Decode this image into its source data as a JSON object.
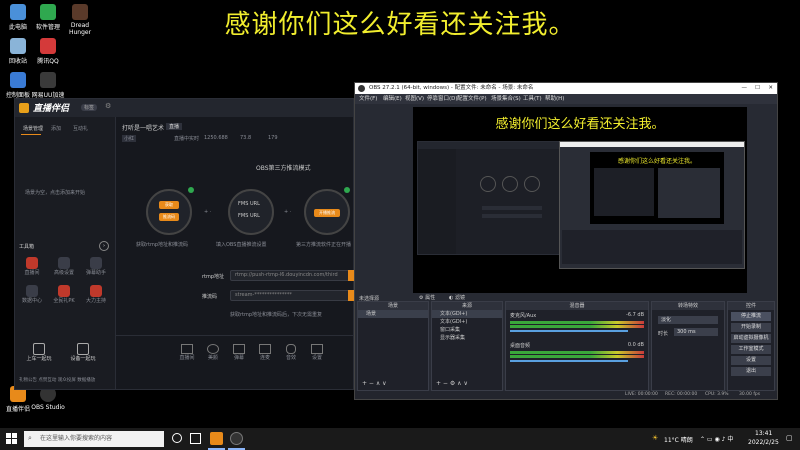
{
  "caption": "感谢你们这么好看还关注我。",
  "desktop_icons": [
    {
      "label": "此电脑",
      "color": "#4a90d9"
    },
    {
      "label": "软件管理",
      "color": "#2fa84f"
    },
    {
      "label": "Dread Hunger",
      "color": "#5a3a2a"
    },
    {
      "label": "回收站",
      "color": "#8ab4d8"
    },
    {
      "label": "腾讯QQ",
      "color": "#d43a3a"
    },
    {
      "label": "控制面板",
      "color": "#3a7bd5"
    },
    {
      "label": "网易UU加速",
      "color": "#3a3a3a"
    }
  ],
  "taskbar_icons": [
    {
      "label": "直播伴侣"
    },
    {
      "label": "OBS Studio"
    }
  ],
  "zhibo": {
    "logo": "直播伴侣",
    "badge": "标签",
    "side_tabs": [
      "场景管理",
      "添加",
      "互动礼"
    ],
    "side_empty_text": "场景为空，点击添加来开始",
    "toolbox_title": "工具箱",
    "tools": [
      {
        "label": "直播间",
        "color": "#c0392b"
      },
      {
        "label": "高级设置",
        "color": "#3a3d48"
      },
      {
        "label": "弹幕助手",
        "color": "#3a3d48"
      },
      {
        "label": "数据中心",
        "color": "#3a3d48"
      },
      {
        "label": "全民礼PK",
        "color": "#c0392b"
      },
      {
        "label": "大力主持",
        "color": "#c0392b"
      }
    ],
    "bottom_left": [
      "上车一起玩",
      "设备一起玩"
    ],
    "stream_title": "打听是一唱艺术",
    "stream_tag": "直播",
    "status_items": [
      "小红",
      "直播中实时",
      "1250.688",
      "73.8",
      "179"
    ],
    "mode_title": "OBS第三方推流模式",
    "steps": [
      {
        "caption": "获取rtmp地址和推流码",
        "btn": "获取"
      },
      {
        "caption": "填入OBS直播推流设置",
        "btn": "FMS URL"
      },
      {
        "caption": "第三方推流软件正在开播",
        "btn": "开播推流"
      }
    ],
    "step_inner_labels": [
      "推流码",
      "FMS URL",
      "推流码"
    ],
    "rtmp_label": "rtmp地址",
    "rtmp_value": "rtmp://push-rtmp-l6.douyincdn.com/third",
    "key_label": "推流码",
    "key_value": "stream-***************",
    "footer_hint": "获取rtmp地址和推流码后，下次无需重复",
    "bottom_tools": [
      "直播间",
      "美颜",
      "弹幕",
      "连麦",
      "音效",
      "设置"
    ],
    "status_bar": "礼物公告  点赞互动  观众投屏  数据播放"
  },
  "obs": {
    "title": "OBS 27.2.1 (64-bit, windows) - 配置文件: 未命名 - 场景: 未命名",
    "menu": [
      "文件(F)",
      "编辑(E)",
      "视图(V)",
      "停靠窗口(D)",
      "配置文件(P)",
      "场景集合(S)",
      "工具(T)",
      "帮助(H)"
    ],
    "preview_caption": "感谢你们这么好看还关注我。",
    "no_source": "未选择源",
    "btn_props": "属性",
    "btn_filters": "滤镜",
    "docks": {
      "scenes": {
        "title": "场景",
        "items": [
          "场景"
        ]
      },
      "sources": {
        "title": "来源",
        "items": [
          "文本(GDI+)",
          "文本(GDI+)",
          "窗口采集",
          "显示器采集"
        ]
      },
      "mixer": {
        "title": "混音器",
        "channels": [
          {
            "name": "麦克风/Aux",
            "db": "-6.7 dB"
          },
          {
            "name": "桌面音频",
            "db": "0.0 dB"
          }
        ]
      },
      "transitions": {
        "title": "转场特效",
        "mode": "淡化",
        "duration_label": "时长",
        "duration": "300 ms"
      },
      "controls": {
        "title": "控件",
        "buttons": [
          "停止推流",
          "开始录制",
          "启动虚拟摄像机",
          "工作室模式",
          "设置",
          "退出"
        ]
      }
    },
    "status": {
      "live": "LIVE: 00:00:00",
      "rec": "REC: 00:00:00",
      "cpu": "CPU: 3.9%",
      "fps": "30.00 fps"
    }
  },
  "taskbar": {
    "search_placeholder": "在这里输入你要搜索的内容",
    "weather": "11°C 晴朗",
    "time": "13:41",
    "date": "2022/2/25"
  }
}
